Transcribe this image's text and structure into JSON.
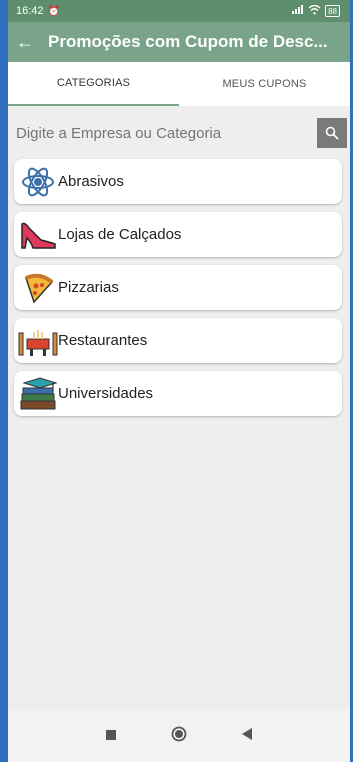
{
  "status": {
    "time": "16:42",
    "battery": "88"
  },
  "appbar": {
    "title": "Promoções com Cupom de Desc..."
  },
  "tabs": [
    {
      "label": "CATEGORIAS"
    },
    {
      "label": "MEUS CUPONS"
    }
  ],
  "search": {
    "placeholder": "Digite a Empresa ou Categoria"
  },
  "categories": [
    {
      "label": "Abrasivos",
      "icon": "atom-icon"
    },
    {
      "label": "Lojas de Calçados",
      "icon": "high-heel-icon"
    },
    {
      "label": "Pizzarias",
      "icon": "pizza-icon"
    },
    {
      "label": "Restaurantes",
      "icon": "restaurant-table-icon"
    },
    {
      "label": "Universidades",
      "icon": "graduation-books-icon"
    }
  ],
  "colors": {
    "appbar": "#7aa48a",
    "statusbar": "#5e8e6e",
    "frame": "#2f6fbf"
  }
}
